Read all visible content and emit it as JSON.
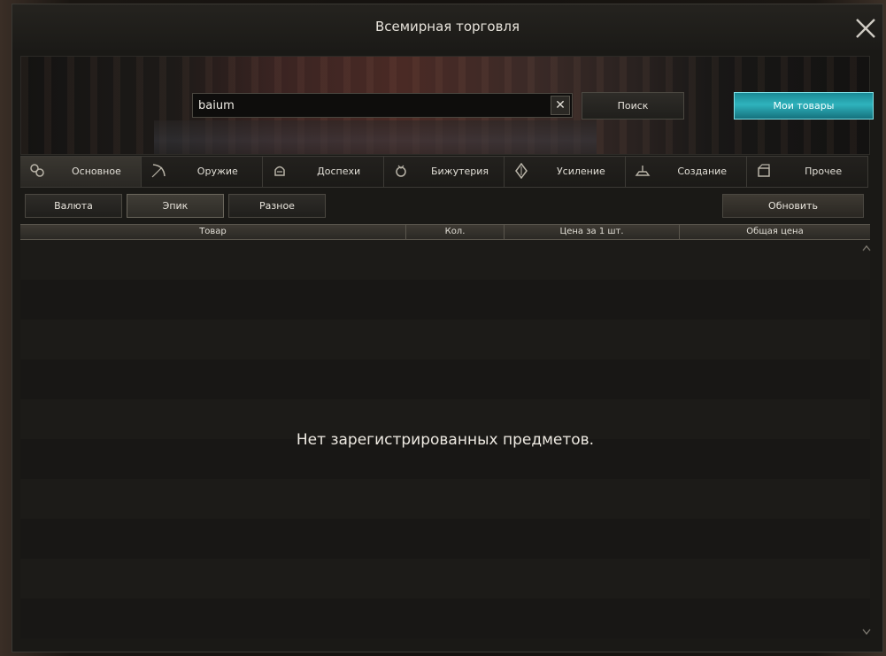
{
  "window": {
    "title": "Всемирная торговля"
  },
  "search": {
    "value": "baium",
    "search_label": "Поиск",
    "my_items_label": "Мои товары"
  },
  "tabs": [
    {
      "label": "Основное",
      "icon": "main-icon"
    },
    {
      "label": "Оружие",
      "icon": "bow-icon"
    },
    {
      "label": "Доспехи",
      "icon": "helmet-icon"
    },
    {
      "label": "Бижутерия",
      "icon": "jewelry-icon"
    },
    {
      "label": "Усиление",
      "icon": "enhance-icon"
    },
    {
      "label": "Создание",
      "icon": "craft-icon"
    },
    {
      "label": "Прочее",
      "icon": "box-icon"
    }
  ],
  "subtabs": [
    {
      "label": "Валюта"
    },
    {
      "label": "Эпик"
    },
    {
      "label": "Разное"
    }
  ],
  "refresh_label": "Обновить",
  "table": {
    "columns": [
      "Товар",
      "Кол.",
      "Цена за 1 шт.",
      "Общая цена"
    ],
    "empty_message": "Нет зарегистрированных предметов."
  },
  "colors": {
    "accent": "#2fb3bd",
    "background": "#1a1916"
  }
}
